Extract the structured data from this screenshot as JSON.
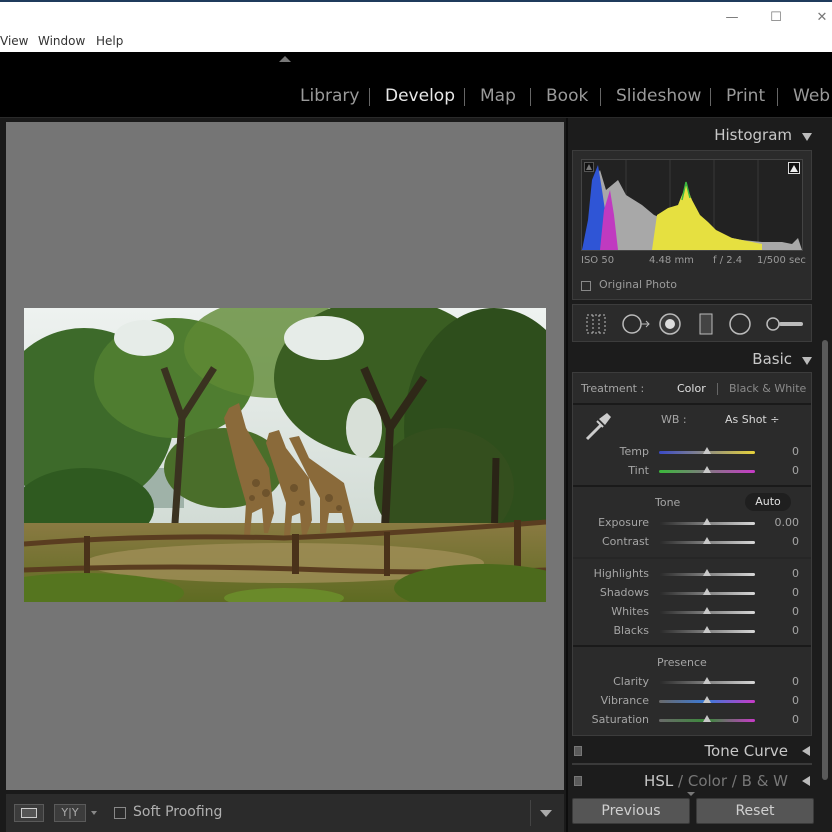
{
  "window": {
    "minimize": "—",
    "maximize": "☐",
    "close": "✕"
  },
  "menu": {
    "items": [
      "View",
      "Window",
      "Help"
    ]
  },
  "modules": {
    "items": [
      "Library",
      "Develop",
      "Map",
      "Book",
      "Slideshow",
      "Print",
      "Web"
    ],
    "active": "Develop"
  },
  "toolbar": {
    "soft_proofing_label": "Soft Proofing",
    "compare_label": "Y|Y"
  },
  "histogram": {
    "title": "Histogram",
    "iso": "ISO 50",
    "focal_length": "4.48 mm",
    "aperture": "f / 2.4",
    "shutter": "1/500 sec",
    "original_photo_label": "Original Photo"
  },
  "basic": {
    "title": "Basic",
    "treatment_label": "Treatment :",
    "treatment_color": "Color",
    "treatment_bw": "Black & White",
    "wb_label": "WB :",
    "wb_value": "As Shot ÷",
    "temp": {
      "label": "Temp",
      "value": "0",
      "level": 0.5
    },
    "tint": {
      "label": "Tint",
      "value": "0",
      "level": 0.5
    },
    "tone_label": "Tone",
    "auto_label": "Auto",
    "exposure": {
      "label": "Exposure",
      "value": "0.00",
      "level": 0.5
    },
    "contrast": {
      "label": "Contrast",
      "value": "0",
      "level": 0.5
    },
    "highlights": {
      "label": "Highlights",
      "value": "0",
      "level": 0.5
    },
    "shadows": {
      "label": "Shadows",
      "value": "0",
      "level": 0.5
    },
    "whites": {
      "label": "Whites",
      "value": "0",
      "level": 0.5
    },
    "blacks": {
      "label": "Blacks",
      "value": "0",
      "level": 0.5
    },
    "presence_label": "Presence",
    "clarity": {
      "label": "Clarity",
      "value": "0",
      "level": 0.5
    },
    "vibrance": {
      "label": "Vibrance",
      "value": "0",
      "level": 0.5
    },
    "saturation": {
      "label": "Saturation",
      "value": "0",
      "level": 0.5
    }
  },
  "tone_curve": {
    "title": "Tone Curve"
  },
  "hsl": {
    "hsl": "HSL",
    "sep": "/",
    "color": "Color",
    "bw": "B & W"
  },
  "buttons": {
    "previous": "Previous",
    "reset": "Reset"
  },
  "colors": {
    "accent": "#e8e8e8",
    "panel": "#2b2b2b",
    "canvas": "#757575"
  }
}
